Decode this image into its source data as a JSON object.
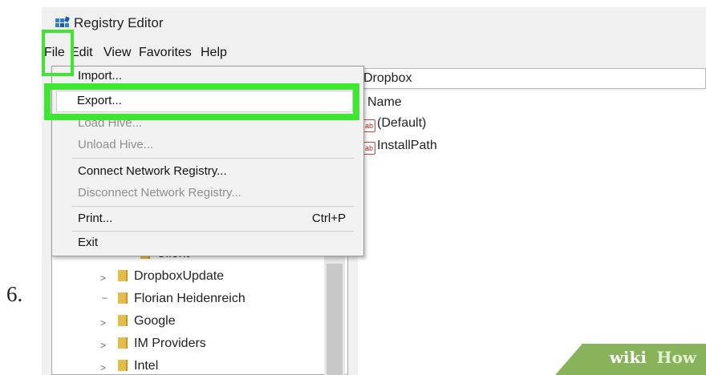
{
  "step_number": "6.",
  "window": {
    "title": "Registry Editor"
  },
  "menubar": [
    "File",
    "Edit",
    "View",
    "Favorites",
    "Help"
  ],
  "address_bar": {
    "path_visible": "Dropbox"
  },
  "file_menu": {
    "items": [
      {
        "label": "Import...",
        "enabled": true
      },
      {
        "label": "Export...",
        "enabled": true,
        "highlighted": true
      },
      {
        "label": "Load Hive...",
        "enabled": false
      },
      {
        "label": "Unload Hive...",
        "enabled": false
      },
      {
        "label": "Connect Network Registry...",
        "enabled": true
      },
      {
        "label": "Disconnect Network Registry...",
        "enabled": false
      },
      {
        "label": "Print...",
        "shortcut": "Ctrl+P",
        "enabled": true
      },
      {
        "label": "Exit",
        "enabled": true
      }
    ]
  },
  "values_pane": {
    "header": "Name",
    "rows": [
      "(Default)",
      "InstallPath"
    ]
  },
  "tree": {
    "items": [
      {
        "label": "Client",
        "expandable": false
      },
      {
        "label": "DropboxUpdate",
        "expandable": true
      },
      {
        "label": "Florian Heidenreich",
        "expandable": false
      },
      {
        "label": "Google",
        "expandable": true
      },
      {
        "label": "IM Providers",
        "expandable": true
      },
      {
        "label": "Intel",
        "expandable": true
      }
    ]
  },
  "watermark": {
    "part1": "wiki",
    "part2": "How"
  },
  "colors": {
    "highlight": "#3ee632",
    "watermark": "#88b35a"
  }
}
